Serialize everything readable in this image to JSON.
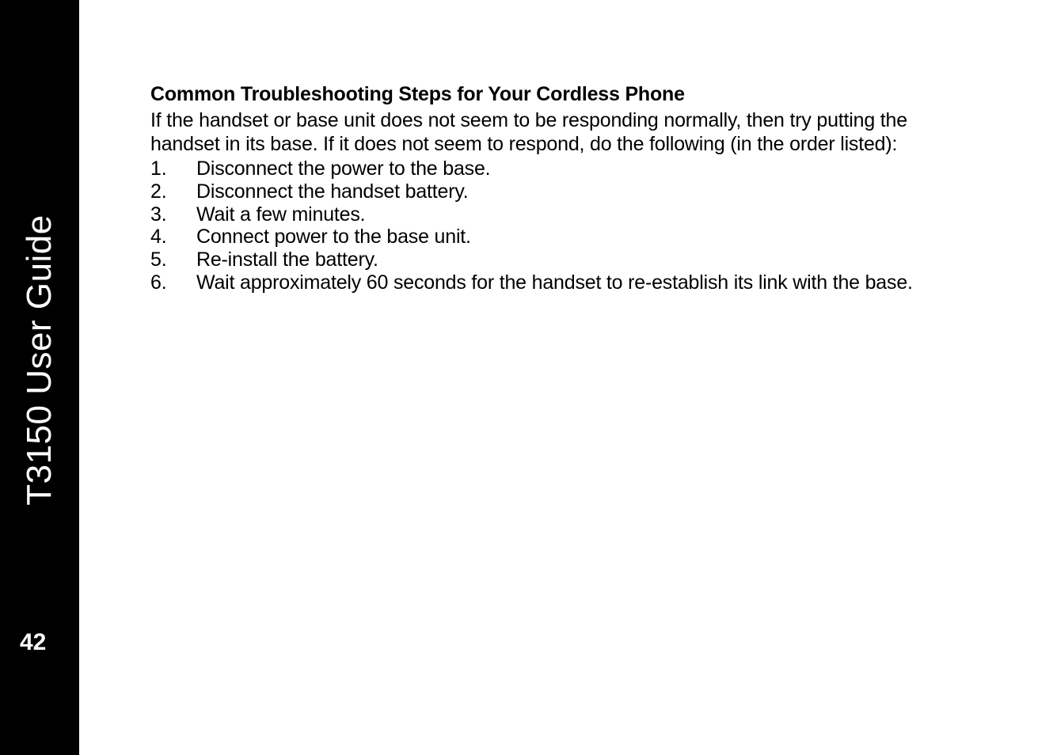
{
  "sidebar": {
    "title": "T3150 User Guide",
    "page_number": "42"
  },
  "content": {
    "heading": "Common Troubleshooting Steps for Your Cordless Phone",
    "intro": "If the handset or base unit does not seem to be responding normally, then try putting the handset in its base. If it does not seem to respond, do the following (in the order listed):",
    "steps": [
      "Disconnect the power to the base.",
      "Disconnect the handset battery.",
      "Wait a few minutes.",
      "Connect power to the base unit.",
      "Re-install the battery.",
      "Wait approximately 60 seconds for the handset to re-establish its link with the base."
    ]
  }
}
